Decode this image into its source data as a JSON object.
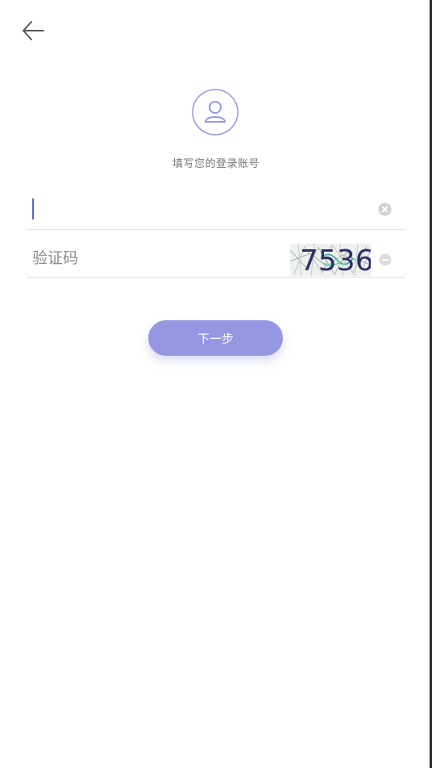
{
  "header": {
    "back_icon": "arrow-left-icon"
  },
  "avatar": {
    "icon": "user-icon",
    "color": "#9597e3"
  },
  "prompt": {
    "text": "填写您的登录账号"
  },
  "account_field": {
    "value": "",
    "placeholder": "",
    "clear_icon": "clear-circle-icon"
  },
  "captcha_field": {
    "placeholder": "验证码",
    "captcha_text": "7536",
    "refresh_icon": "refresh-circle-icon"
  },
  "next_button": {
    "label": "下一步",
    "color": "#9597e3"
  },
  "colors": {
    "accent": "#9597e3",
    "caret": "#4f66d3"
  }
}
